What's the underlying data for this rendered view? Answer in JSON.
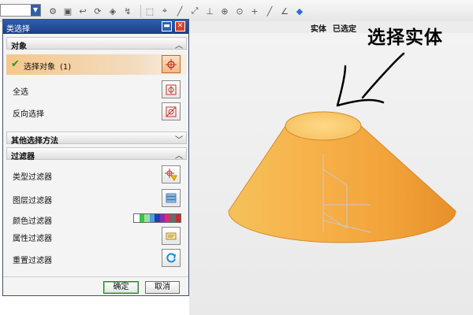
{
  "toolbar": {
    "icons": [
      "dropdown-arrow",
      "box-icon",
      "rotate-icon",
      "cube-icon",
      "pan-icon",
      "marquee-icon",
      "snap-point-icon",
      "line-icon",
      "dash-line-icon",
      "perpendicular-icon",
      "circle-center-icon",
      "cross-icon",
      "line-tool-icon",
      "cube-blue-icon"
    ]
  },
  "status": {
    "solid": "实体",
    "selected": "已选定"
  },
  "annotation": {
    "text": "选择实体"
  },
  "dialog": {
    "title": "类选择",
    "sections": {
      "object": "对象",
      "other_methods": "其他选择方法",
      "filter": "过滤器"
    },
    "object_rows": {
      "select_label": "选择对象",
      "count": "(1)",
      "select_all": "全选",
      "invert": "反向选择"
    },
    "filter_rows": {
      "type": "类型过滤器",
      "layer": "图层过滤器",
      "color": "颜色过滤器",
      "attribute": "属性过滤器",
      "reset": "重置过滤器"
    },
    "buttons": {
      "ok": "确定",
      "cancel": "取消"
    }
  },
  "colors": {
    "accent": "#f0a020",
    "title_bar": "#1f4a9a",
    "selection_row": "#f6c78b"
  }
}
